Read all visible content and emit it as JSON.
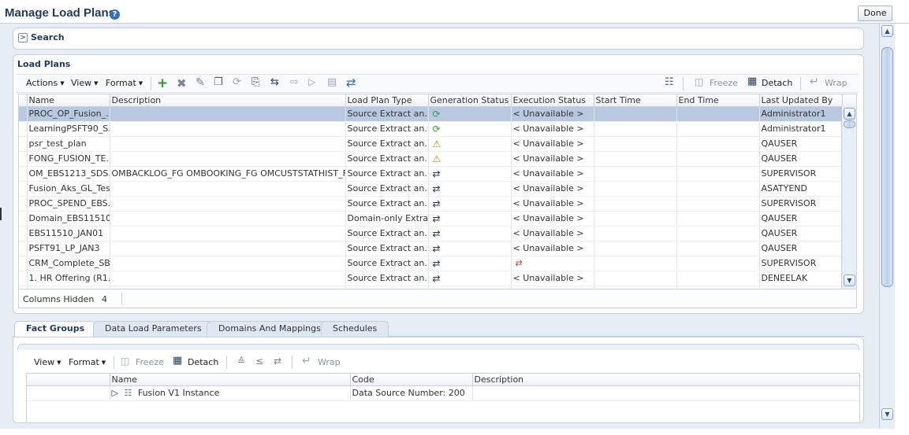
{
  "page": {
    "title": "Manage Load Plans",
    "help_icon": "?",
    "done_label": "Done"
  },
  "search": {
    "expand_icon": ">",
    "title": "Search"
  },
  "load_plans": {
    "title": "Load Plans",
    "menu": [
      "Actions",
      "View",
      "Format"
    ],
    "icons": [
      "add-icon",
      "delete-icon",
      "edit-icon",
      "copy-icon",
      "refresh-icon",
      "generate-icon",
      "reset-icon",
      "export-icon",
      "run-icon",
      "schedule-icon",
      "sync-icon"
    ],
    "freeze_label": "Freeze",
    "detach_label": "Detach",
    "wrap_label": "Wrap",
    "columns": [
      "Name",
      "Description",
      "Load Plan Type",
      "Generation Status",
      "Execution Status",
      "Start Time",
      "End Time",
      "Last Updated By"
    ],
    "rows": [
      {
        "name": "PROC_OP_Fusion_...",
        "description": "",
        "type": "Source Extract an...",
        "gen": "refresh-green",
        "exec": "< Unavailable >",
        "updated_by": "Administrator1",
        "selected": true
      },
      {
        "name": "LearningPSFT90_S...",
        "description": "",
        "type": "Source Extract an...",
        "gen": "refresh-green",
        "exec": "< Unavailable >",
        "updated_by": "Administrator1"
      },
      {
        "name": "psr_test_plan",
        "description": "",
        "type": "Source Extract an...",
        "gen": "warning",
        "exec": "< Unavailable >",
        "updated_by": "QAUSER"
      },
      {
        "name": "FONG_FUSION_TE...",
        "description": "",
        "type": "Source Extract an...",
        "gen": "warning",
        "exec": "< Unavailable >",
        "updated_by": "QAUSER"
      },
      {
        "name": "OM_EBS1213_SDS...",
        "description": "OMBACKLOG_FG OMBOOKING_FG OMCUSTSTATHIST_FG (...",
        "type": "Source Extract an...",
        "gen": "complete",
        "exec": "< Unavailable >",
        "updated_by": "SUPERVISOR"
      },
      {
        "name": "Fusion_Aks_GL_Test",
        "description": "",
        "type": "Source Extract an...",
        "gen": "complete",
        "exec": "< Unavailable >",
        "updated_by": "ASATYEND"
      },
      {
        "name": "PROC_SPEND_EBS...",
        "description": "",
        "type": "Source Extract an...",
        "gen": "complete",
        "exec": "< Unavailable >",
        "updated_by": "SUPERVISOR"
      },
      {
        "name": "Domain_EBS11510...",
        "description": "",
        "type": "Domain-only Extra...",
        "gen": "complete",
        "exec": "< Unavailable >",
        "updated_by": "QAUSER"
      },
      {
        "name": "EBS11510_JAN01",
        "description": "",
        "type": "Source Extract an...",
        "gen": "complete",
        "exec": "< Unavailable >",
        "updated_by": "QAUSER"
      },
      {
        "name": "PSFT91_LP_JAN3",
        "description": "",
        "type": "Source Extract an...",
        "gen": "complete",
        "exec": "< Unavailable >",
        "updated_by": "QAUSER"
      },
      {
        "name": "CRM_Complete_SB...",
        "description": "",
        "type": "Source Extract an...",
        "gen": "complete",
        "exec": "",
        "exec_icon": "failed",
        "updated_by": "SUPERVISOR"
      },
      {
        "name": "1. HR Offering (R1...",
        "description": "",
        "type": "Source Extract an...",
        "gen": "complete",
        "exec": "< Unavailable >",
        "updated_by": "DENEELAK"
      }
    ],
    "columns_hidden_label": "Columns Hidden",
    "columns_hidden_count": "4"
  },
  "tabs": [
    "Fact Groups",
    "Data Load Parameters",
    "Domains And Mappings",
    "Schedules"
  ],
  "fact_groups": {
    "menu": [
      "View",
      "Format"
    ],
    "freeze_label": "Freeze",
    "detach_label": "Detach",
    "wrap_label": "Wrap",
    "columns": [
      "Name",
      "Code",
      "Description"
    ],
    "rows": [
      {
        "name": "Fusion V1 Instance",
        "code": "Data Source Number: 200",
        "description": ""
      }
    ]
  }
}
